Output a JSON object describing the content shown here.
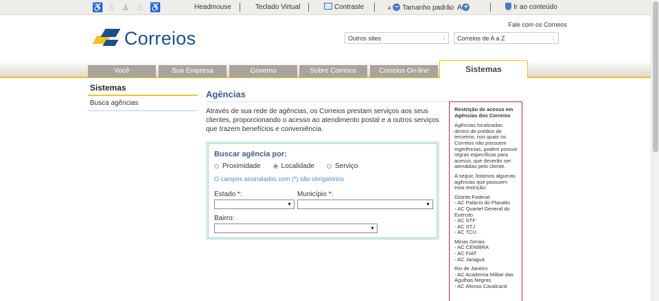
{
  "topbar": {
    "headmouse": "Headmouse",
    "teclado": "Teclado Virtual",
    "contraste": "Contraste",
    "small_a": "A",
    "tamanho": "Tamanho padrão",
    "big_a": "A",
    "ir_conteudo": "Ir ao conteúdo"
  },
  "header": {
    "logo_text": "Correios",
    "fale_conosco": "Fale com os Correios",
    "outros_sites": "Outros sites",
    "correios_az": "Correios de A a Z"
  },
  "nav": {
    "tabs": [
      "Você",
      "Sua Empresa",
      "Governo",
      "Sobre Correios",
      "Correios On-line"
    ],
    "active_tab": "Sistemas"
  },
  "sidebar": {
    "title": "Sistemas",
    "items": [
      "Busca agências"
    ]
  },
  "main": {
    "title": "Agências",
    "intro": "Através de sua rede de agências, os Correios prestam serviços aos seus clientes, proporcionando o acesso ao atendimento postal e a outros serviços que trazem benefícios e conveniência.",
    "search": {
      "title": "Buscar agência por:",
      "options": [
        "Proximidade",
        "Localidade",
        "Serviço"
      ],
      "selected": "Localidade",
      "required_note": "O campos assinalados com (*) são obrigatórios",
      "estado_label": "Estado *:",
      "municipio_label": "Município *:",
      "bairro_label": "Bairro:",
      "estado_value": "",
      "municipio_value": "",
      "bairro_value": ""
    }
  },
  "restriction": {
    "title": "Restrição de acesso em Agências dos Correios",
    "p1": "Agências localizadas dentro de prédios de terceiros, nos quais os Correios não possuem ingerências, podem possuir regras específicas para acesso, que deverão ser atendidas pelo cliente.",
    "p2": "A seguir, listamos algumas agências que possuem esta restrição:",
    "groups": [
      {
        "name": "Distrito Federal:",
        "items": [
          "- AC Palácio do Planalto",
          "- AC Quartel General do Exército",
          "- AC STF",
          "- AC STJ",
          "- AC TCU"
        ]
      },
      {
        "name": "Minas Gerais",
        "items": [
          "- AC CENIBRA",
          "- AC FIAT",
          "- AC Jaraguá"
        ]
      },
      {
        "name": "Rio de Janeiro",
        "items": [
          "- AC Academia Militar das Agulhas Negras",
          "- AC Afonso Cavalcanti"
        ]
      }
    ]
  },
  "colors": {
    "brand_blue": "#1b4e8c",
    "brand_yellow": "#f5c21b",
    "tab_gray": "#a9a49b",
    "restriction_border": "#c9252b"
  }
}
